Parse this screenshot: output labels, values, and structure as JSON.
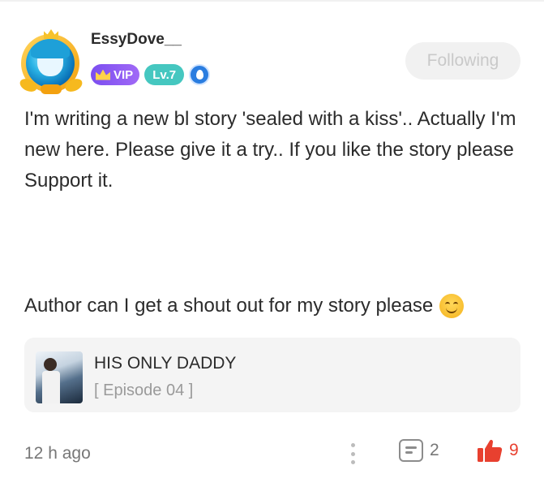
{
  "post": {
    "username": "EssyDove__",
    "badges": {
      "vip": "VIP",
      "level": "Lv.7"
    },
    "follow_label": "Following",
    "body": [
      "I'm writing a new bl story 'sealed with a kiss'.. Actually I'm new here. Please give it a try.. If you like the story please Support it."
    ],
    "second_line": "Author can I get a shout out for my story please",
    "linked_story": {
      "title": "HIS ONLY DADDY",
      "episode": "[ Episode 04 ]"
    },
    "footer": {
      "timestamp": "12 h ago",
      "comment_count": "2",
      "like_count": "9"
    }
  },
  "colors": {
    "vip_purple": "#8a59f3",
    "level_teal": "#45c7c0",
    "like_red": "#e8402f",
    "shield_blue": "#2a7de0"
  },
  "icons": {
    "avatar_frame": "crown-wings-frame",
    "vip": "crown-icon",
    "badge": "shield-icon",
    "more": "more-vertical-icon",
    "comment": "comment-icon",
    "like": "thumbs-up-icon",
    "emoji": "smiling-face-emoji"
  }
}
